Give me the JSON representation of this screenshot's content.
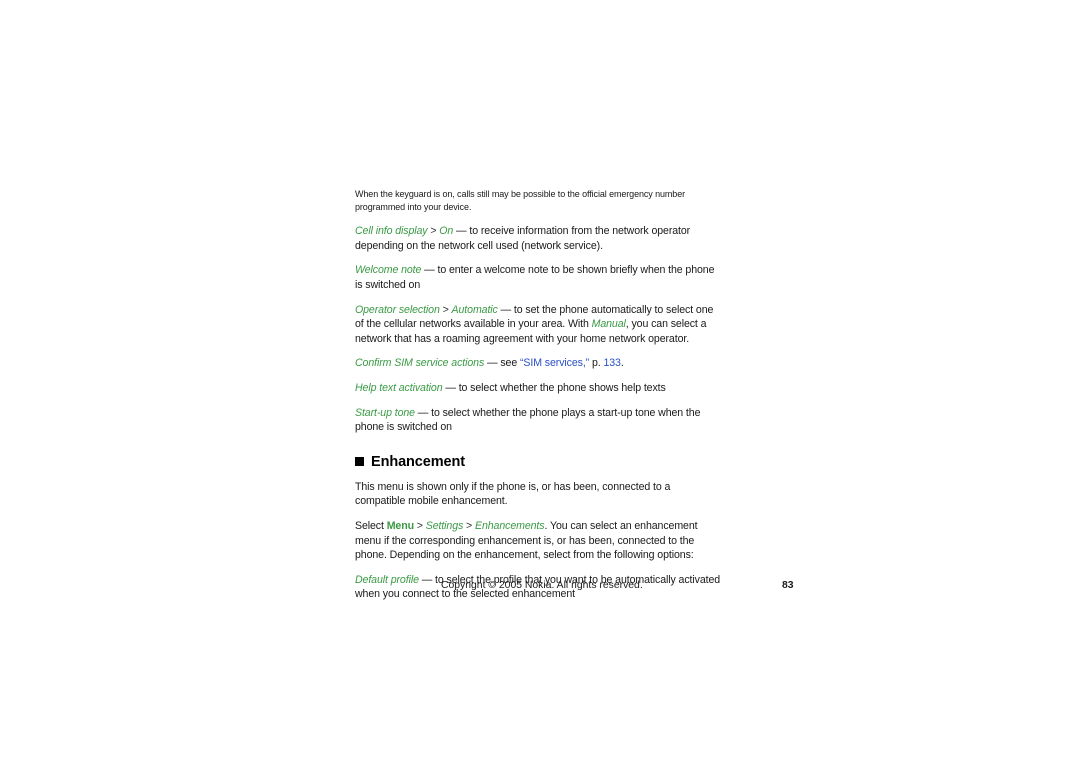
{
  "document": {
    "title": "Nokia user guide page 83",
    "accent_green": "#3a9a45",
    "link_blue": "#2b4fc4",
    "text_black": "#1a1a1a",
    "background": "#ffffff"
  },
  "note": {
    "text": "When the keyguard is on, calls still may be possible to the official emergency number programmed into your device."
  },
  "entries": {
    "cell_info": {
      "term": "Cell info display",
      "sep1": " > ",
      "value": "On",
      "body": " — to receive information from the network operator depending on the network cell used (network service)."
    },
    "welcome_note": {
      "term": "Welcome note",
      "body": " — to enter a welcome note to be shown briefly when the phone is switched on"
    },
    "operator_selection": {
      "term": "Operator selection",
      "sep1": " > ",
      "value": "Automatic",
      "body1": " — to set the phone automatically to select one of the cellular networks available in your area. With ",
      "value2": "Manual",
      "body2": ", you can select a network that has a roaming agreement with your home network operator."
    },
    "confirm_sim": {
      "term": "Confirm SIM service actions",
      "body1": " — see ",
      "link_text": "“SIM services,”",
      "body2": " p. ",
      "link_page": "133",
      "body3": "."
    },
    "help_text": {
      "term": "Help text activation",
      "body": " — to select whether the phone shows help texts"
    },
    "startup_tone": {
      "term": "Start-up tone",
      "body": " — to select whether the phone plays a start-up tone when the phone is switched on"
    }
  },
  "enhancement_section": {
    "heading": "Enhancement",
    "intro": "This menu is shown only if the phone is, or has been, connected to a compatible mobile enhancement.",
    "select_path": {
      "lead": "Select ",
      "menu": "Menu",
      "sep1": " > ",
      "settings": "Settings",
      "sep2": " > ",
      "enhancements": "Enhancements",
      "body": ". You can select an enhancement menu if the corresponding enhancement is, or has been, connected to the phone. Depending on the enhancement, select from the following options:"
    },
    "default_profile": {
      "term": "Default profile",
      "body": " — to select the profile that you want to be automatically activated when you connect to the selected enhancement"
    }
  },
  "footer": {
    "copyright": "Copyright © 2005 Nokia. All rights reserved.",
    "page_number": "83"
  }
}
